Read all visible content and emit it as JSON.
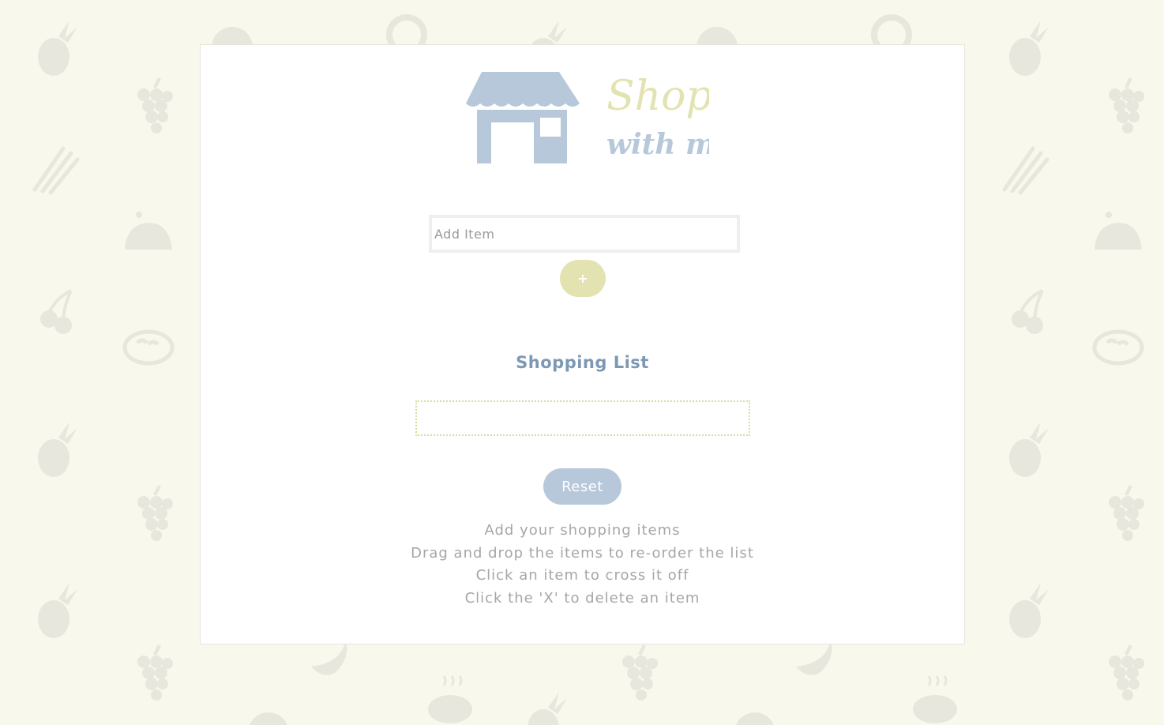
{
  "colors": {
    "background": "#f8f8ec",
    "card": "#ffffff",
    "store_blue": "#b6c8da",
    "shop_yellow": "#e3e3b2",
    "title_blue": "#7d98b3",
    "text_gray": "#a6a6a6",
    "list_border": "#d8dca0"
  },
  "logo": {
    "line1": "Shop",
    "line2": "with me",
    "icon": "store-icon"
  },
  "add_item": {
    "placeholder": "Add Item",
    "value": "",
    "button_label": "+"
  },
  "shopping_list": {
    "title": "Shopping List",
    "items": []
  },
  "reset": {
    "label": "Reset"
  },
  "instructions": [
    "Add your shopping items",
    "Drag and drop the items to re-order the list",
    "Click an item to cross it off",
    "Click the 'X' to delete an item"
  ],
  "background_icons": [
    "pineapple-icon",
    "watermelon-icon",
    "donut-icon",
    "grapes-icon",
    "asparagus-icon",
    "chicken-icon",
    "cherries-icon",
    "bread-icon",
    "banana-icon",
    "steak-icon"
  ]
}
